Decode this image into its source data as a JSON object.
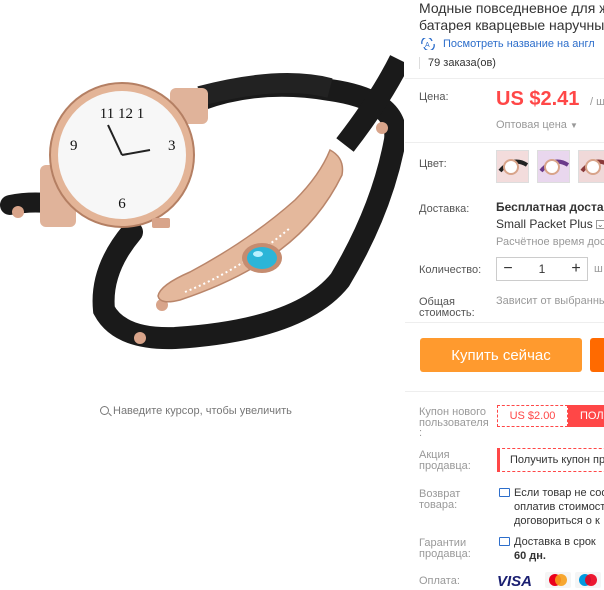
{
  "product": {
    "title_line1": "Модные повседневное для ж",
    "title_line2": "батарея кварцевые наручны",
    "translate_link": "Посмотреть название на англ",
    "orders": "79 заказа(ов)"
  },
  "gallery": {
    "zoom_hint": "Наведите курсор, чтобы увеличить"
  },
  "price": {
    "label": "Цена:",
    "value": "US $2.41",
    "unit": "/ шт",
    "wholesale": "Оптовая цена"
  },
  "color": {
    "label": "Цвет:"
  },
  "shipping": {
    "label": "Доставка:",
    "free": "Бесплатная доставка",
    "method": "Small Packet Plus",
    "estimate": "Расчётное время дос"
  },
  "quantity": {
    "label": "Количество:",
    "minus": "−",
    "value": "1",
    "plus": "+",
    "unit": "ш"
  },
  "total": {
    "label_line1": "Общая",
    "label_line2": "стоимость:",
    "note": "Зависит от выбранны"
  },
  "actions": {
    "buy_label": "Купить сейчас"
  },
  "coupon": {
    "label_line1": "Купон нового",
    "label_line2": "пользователя",
    "label_line3": ":",
    "amount": "US $2.00",
    "get": "ПОЛ"
  },
  "promo": {
    "label_line1": "Акция",
    "label_line2": "продавца:",
    "text": "Получить купон пр"
  },
  "returns": {
    "label_line1": "Возврат",
    "label_line2": "товара:",
    "line1": "Если товар не соо",
    "line2": "оплатив стоимост",
    "line3": "договориться о к"
  },
  "guarantee": {
    "label_line1": "Гарантии",
    "label_line2": "продавца:",
    "line1": "Доставка в срок",
    "line2": "60 дн."
  },
  "payment": {
    "label": "Оплата:",
    "visa": "VISA"
  },
  "colors": {
    "price": "#ff4747",
    "buy_button": "#ff9a2e",
    "link": "#2d6ecb"
  }
}
